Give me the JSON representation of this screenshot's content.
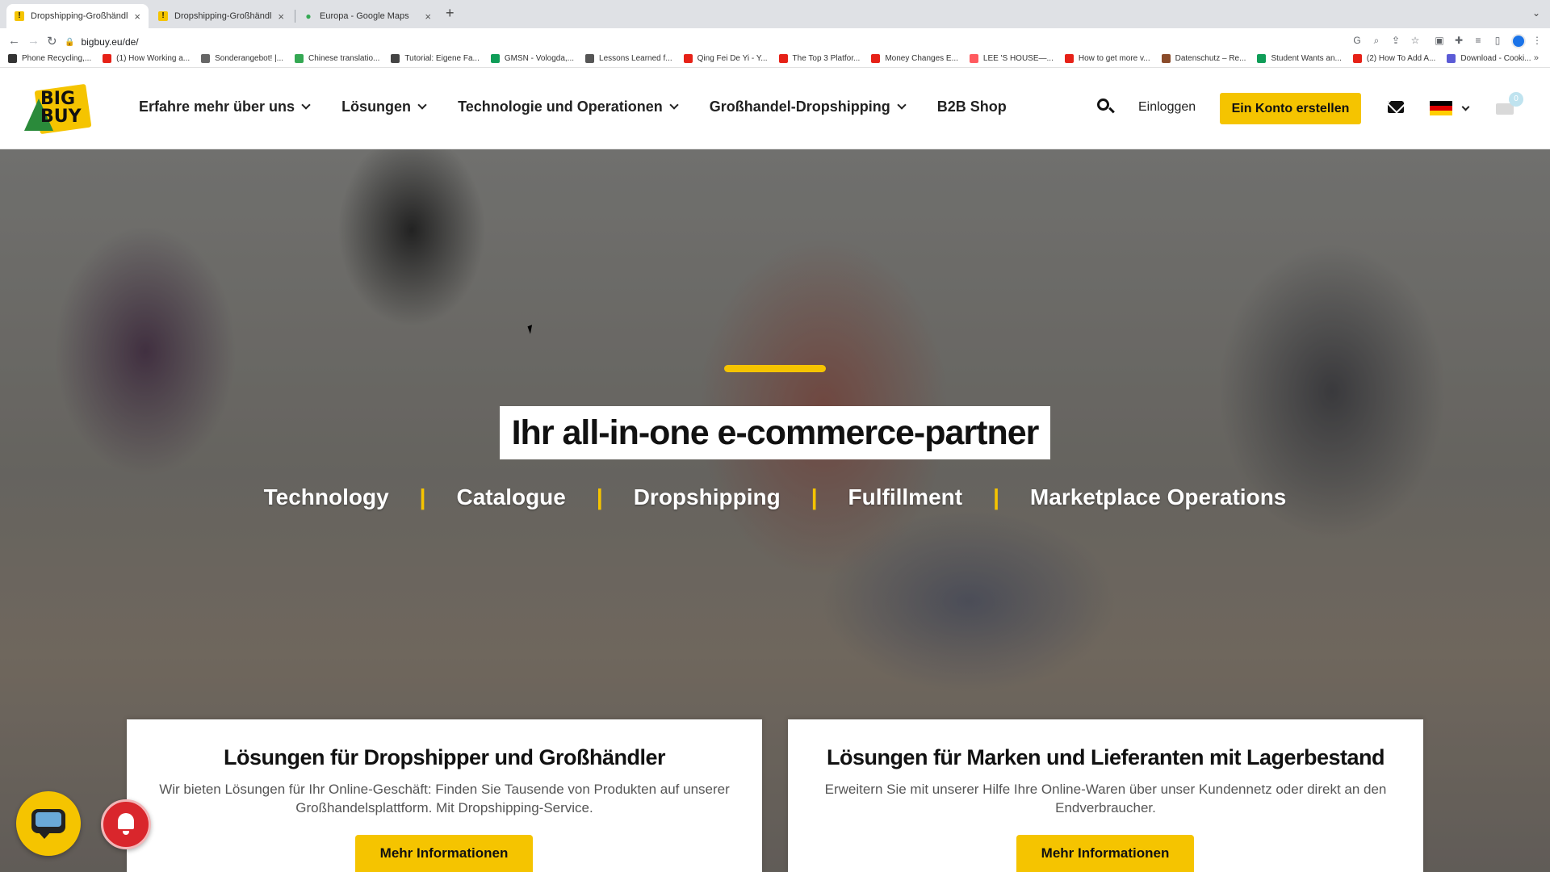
{
  "browser": {
    "tabs": [
      {
        "title": "Dropshipping-Großhändler. Bi",
        "favicon": "bigbuy-favicon",
        "active": true
      },
      {
        "title": "Dropshipping-Großhändler | Bi",
        "favicon": "bigbuy-favicon",
        "active": false
      },
      {
        "title": "Europa - Google Maps",
        "favicon": "maps-pin-icon",
        "active": false
      }
    ],
    "url": "bigbuy.eu/de/",
    "bookmarks": [
      {
        "label": "Phone Recycling,...",
        "color": "#333333"
      },
      {
        "label": "(1) How Working a...",
        "color": "#e62117"
      },
      {
        "label": "Sonderangebot! |...",
        "color": "#666666"
      },
      {
        "label": "Chinese translatio...",
        "color": "#34a853"
      },
      {
        "label": "Tutorial: Eigene Fa...",
        "color": "#444444"
      },
      {
        "label": "GMSN - Vologda,...",
        "color": "#0f9d58"
      },
      {
        "label": "Lessons Learned f...",
        "color": "#555555"
      },
      {
        "label": "Qing Fei De Yi - Y...",
        "color": "#e62117"
      },
      {
        "label": "The Top 3 Platfor...",
        "color": "#e62117"
      },
      {
        "label": "Money Changes E...",
        "color": "#e62117"
      },
      {
        "label": "LEE 'S HOUSE—...",
        "color": "#ff5a5f"
      },
      {
        "label": "How to get more v...",
        "color": "#e62117"
      },
      {
        "label": "Datenschutz – Re...",
        "color": "#8a4b2a"
      },
      {
        "label": "Student Wants an...",
        "color": "#0f9d58"
      },
      {
        "label": "(2) How To Add A...",
        "color": "#e62117"
      },
      {
        "label": "Download - Cooki...",
        "color": "#5b5bd6"
      }
    ]
  },
  "site": {
    "logo_text": "BIG BUY",
    "nav": [
      {
        "label": "Erfahre mehr über uns",
        "dropdown": true
      },
      {
        "label": "Lösungen",
        "dropdown": true
      },
      {
        "label": "Technologie und Operationen",
        "dropdown": true
      },
      {
        "label": "Großhandel-Dropshipping",
        "dropdown": true
      },
      {
        "label": "B2B Shop",
        "dropdown": false
      }
    ],
    "login_label": "Einloggen",
    "cta_label": "Ein Konto erstellen",
    "cart_count": "0",
    "language_flag": "de-flag-icon"
  },
  "hero": {
    "title": "Ihr all-in-one e-commerce-partner",
    "items": [
      "Technology",
      "Catalogue",
      "Dropshipping",
      "Fulfillment",
      "Marketplace Operations"
    ],
    "separator": "|"
  },
  "cards": [
    {
      "title": "Lösungen für Dropshipper und Großhändler",
      "text": "Wir bieten Lösungen für Ihr Online-Geschäft: Finden Sie Tausende von Produkten auf unserer Großhandelsplattform. Mit Dropshipping-Service.",
      "button": "Mehr Informationen"
    },
    {
      "title": "Lösungen für Marken und Lieferanten mit Lagerbestand",
      "text": "Erweitern Sie mit unserer Hilfe Ihre Online-Waren über unser Kundennetz oder direkt an den Endverbraucher.",
      "button": "Mehr Informationen"
    }
  ],
  "colors": {
    "brand_yellow": "#f5c400",
    "notification_red": "#d9262c"
  }
}
